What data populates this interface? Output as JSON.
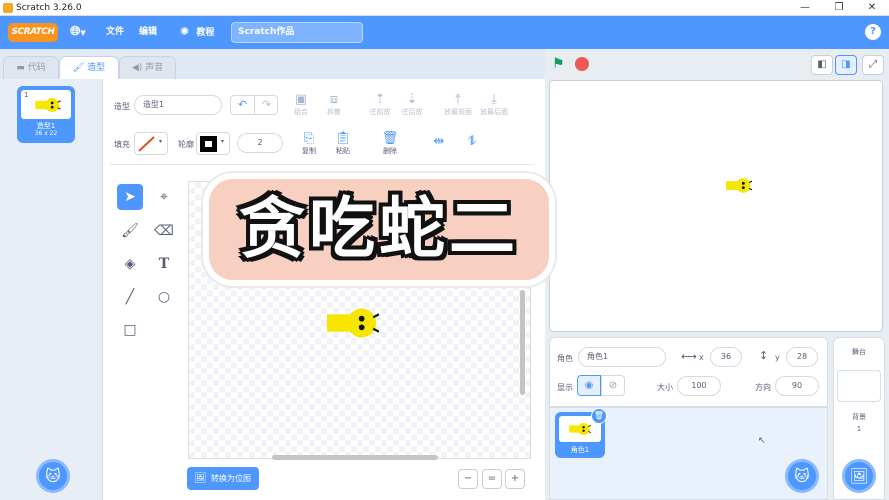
{
  "window": {
    "title": "Scratch 3.26.0",
    "min": "—",
    "max": "❐",
    "close": "✕"
  },
  "menu": {
    "logo": "SCRATCH",
    "language_icon": "globe-icon",
    "file": "文件",
    "edit": "编辑",
    "tutorial": "教程",
    "project_title": "Scratch作品",
    "help": "?"
  },
  "tabs": {
    "code": "代码",
    "costume": "造型",
    "sound": "声音"
  },
  "costume_list": [
    {
      "index": "1",
      "name": "造型1",
      "size": "36 x 22"
    }
  ],
  "editor": {
    "costume_label": "造型",
    "costume_name": "造型1",
    "fill_label": "填充",
    "outline_label": "轮廓",
    "outline_width": "2",
    "buttons": {
      "group": "组合",
      "ungroup": "拆散",
      "forward": "往前放",
      "backward": "往后放",
      "front": "放最前面",
      "back": "放最后面",
      "copy": "复制",
      "paste": "粘贴",
      "delete": "删除"
    },
    "convert_button": "转换为位图",
    "zoom_out": "−",
    "zoom_reset": "=",
    "zoom_in": "+"
  },
  "banner": {
    "text": "贪吃蛇二"
  },
  "sprite_info": {
    "sprite_label": "角色",
    "sprite_name": "角色1",
    "x_label": "x",
    "x_value": "36",
    "y_label": "y",
    "y_value": "28",
    "show_label": "显示",
    "size_label": "大小",
    "size_value": "100",
    "direction_label": "方向",
    "direction_value": "90"
  },
  "sprites": [
    {
      "name": "角色1"
    }
  ],
  "stage_panel": {
    "title": "舞台",
    "backdrop_label": "背景",
    "backdrop_count": "1"
  },
  "colors": {
    "accent": "#4d97ff",
    "menubar": "#4d97ff",
    "logo": "#f7931e",
    "snake": "#f7e600",
    "banner": "#f7d0c2"
  }
}
